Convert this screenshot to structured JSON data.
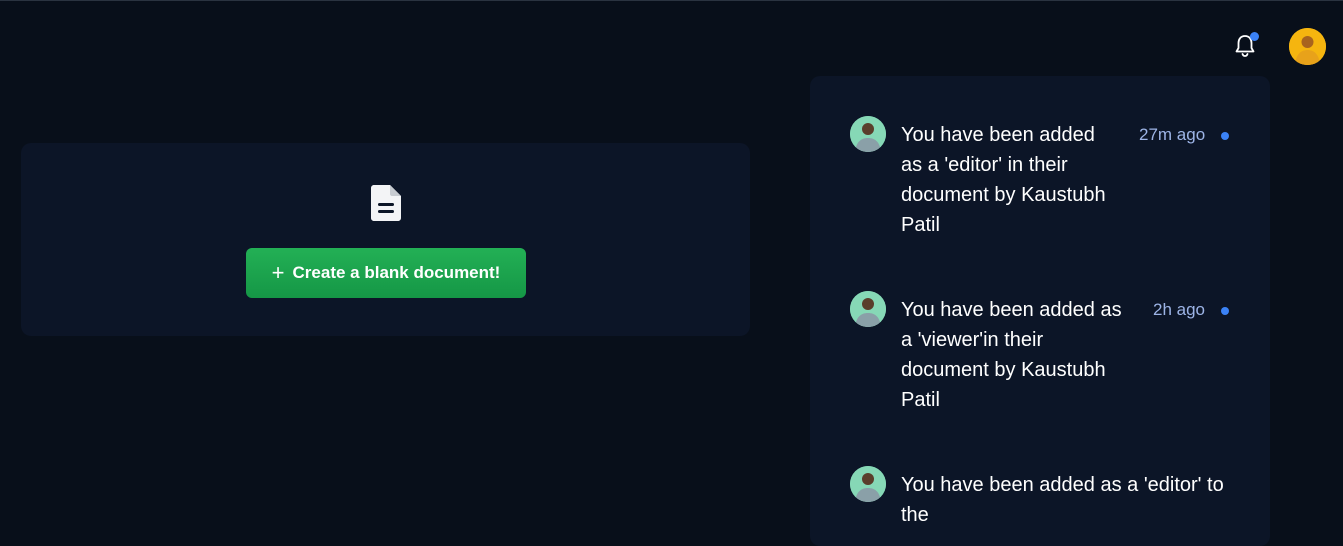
{
  "header": {
    "bell_icon": "bell-icon",
    "notification_indicator_color": "#3b82f6",
    "avatar_color": "#f5b50f"
  },
  "main": {
    "doc_icon": "document-icon",
    "create_button": {
      "icon": "plus-icon",
      "label": "Create a blank document!"
    },
    "button_color": "#1fa94f"
  },
  "notifications": [
    {
      "message_lines": [
        "You have been added",
        "as a 'editor' in their",
        "document by Kaustubh",
        "Patil"
      ],
      "time": "27m ago",
      "unread": true
    },
    {
      "message_lines": [
        "You have been added as",
        "a 'viewer'in their",
        "document by Kaustubh",
        "Patil"
      ],
      "time": "2h ago",
      "unread": true
    },
    {
      "message_lines": [
        "You have been added as a 'editor' to",
        "the"
      ],
      "time": "",
      "unread": false
    }
  ]
}
